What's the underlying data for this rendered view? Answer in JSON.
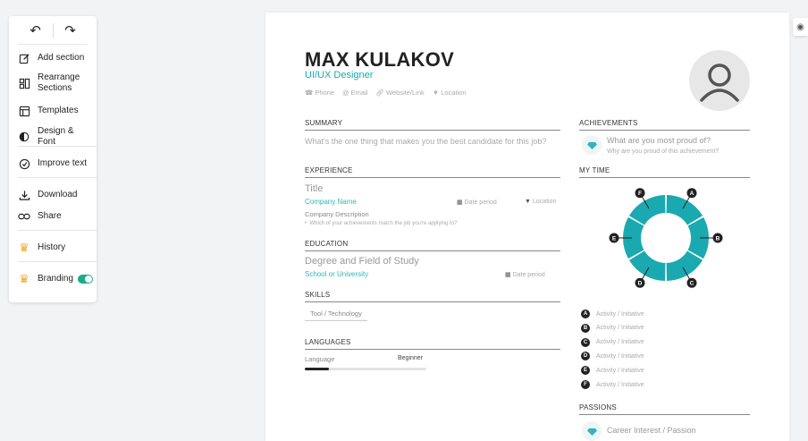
{
  "sidebar": {
    "items": [
      {
        "label": "Add section",
        "icon": "edit-icon"
      },
      {
        "label": "Rearrange Sections",
        "icon": "layout-icon"
      },
      {
        "label": "Templates",
        "icon": "template-icon"
      },
      {
        "label": "Design & Font",
        "icon": "contrast-icon"
      },
      {
        "label": "Improve text",
        "icon": "check-circle-icon"
      },
      {
        "label": "Download",
        "icon": "download-icon"
      },
      {
        "label": "Share",
        "icon": "link-icon"
      },
      {
        "label": "History",
        "icon": "crown-icon"
      },
      {
        "label": "Branding",
        "icon": "crown-icon"
      }
    ],
    "branding_on": true
  },
  "resume": {
    "name": "MAX KULAKOV",
    "role": "UI/UX Designer",
    "contacts": [
      "Phone",
      "Email",
      "Website/Link",
      "Location"
    ],
    "summary": {
      "heading": "SUMMARY",
      "text": "What's the one thing that makes you the best candidate for this job?"
    },
    "experience": {
      "heading": "EXPERIENCE",
      "title": "Title",
      "company": "Company Name",
      "date": "Date period",
      "location": "Location",
      "description": "Company Description",
      "bullet": "Which of your achievements match the job you're applying to?"
    },
    "education": {
      "heading": "EDUCATION",
      "degree": "Degree and Field of Study",
      "school": "School or University",
      "date": "Date period"
    },
    "skills": {
      "heading": "SKILLS",
      "items": [
        "Tool / Technology"
      ]
    },
    "languages": {
      "heading": "LANGUAGES",
      "name": "Language",
      "level": "Beginner",
      "level_fraction": 0.2
    },
    "achievements": {
      "heading": "ACHIEVEMENTS",
      "title": "What are you most proud of?",
      "subtitle": "Why are you proud of this achievement?"
    },
    "my_time": {
      "heading": "MY TIME",
      "segments": [
        "A",
        "B",
        "C",
        "D",
        "E",
        "F"
      ],
      "legend": [
        {
          "letter": "A",
          "label": "Activity / Initiative"
        },
        {
          "letter": "B",
          "label": "Activity / Initiative"
        },
        {
          "letter": "C",
          "label": "Activity / Initiative"
        },
        {
          "letter": "D",
          "label": "Activity / Initiative"
        },
        {
          "letter": "E",
          "label": "Activity / Initiative"
        },
        {
          "letter": "F",
          "label": "Activity / Initiative"
        }
      ],
      "color": "#1aa9b1"
    },
    "passions": {
      "heading": "PASSIONS",
      "item": "Career Interest / Passion"
    }
  }
}
